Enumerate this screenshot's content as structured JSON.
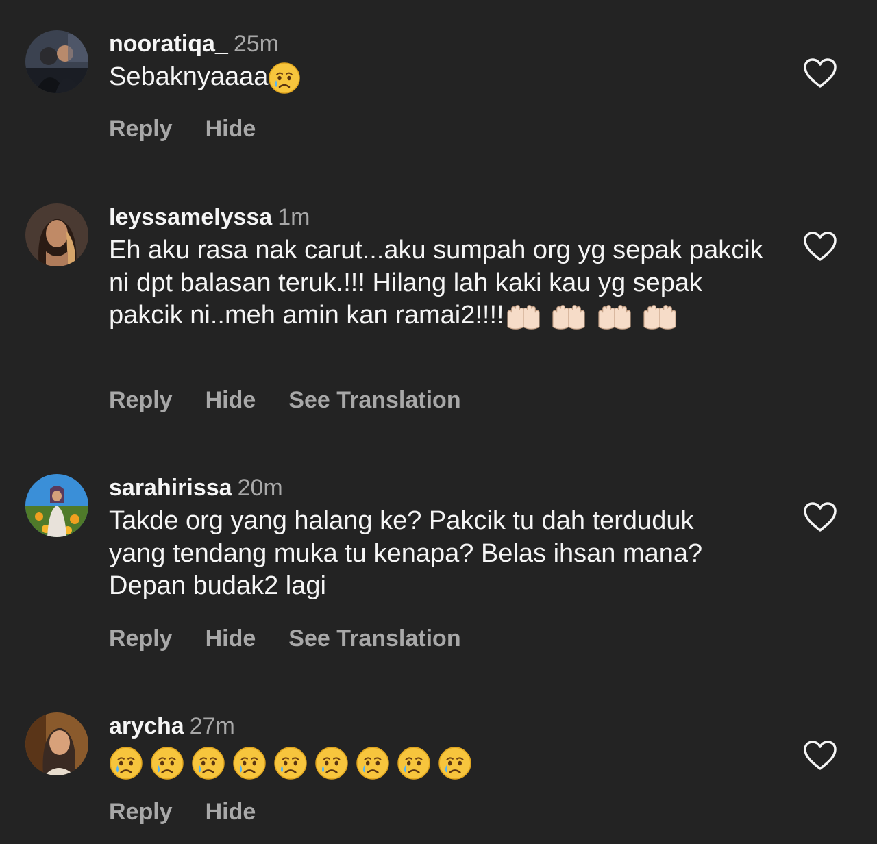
{
  "comments": [
    {
      "username": "nooratiqa_",
      "time": "25m",
      "text": "Sebaknyaaaa",
      "emoji_after": [
        "crying-face"
      ],
      "actions": [
        "Reply",
        "Hide"
      ]
    },
    {
      "username": "leyssamelyssa",
      "time": "1m",
      "text": "Eh aku rasa nak carut...aku sumpah org yg sepak pakcik ni dpt balasan teruk.!!! Hilang lah kaki kau yg sepak pakcik ni..meh amin kan ramai2!!!!",
      "emoji_after": [
        "palms-up-together",
        "palms-up-together",
        "palms-up-together",
        "palms-up-together"
      ],
      "actions": [
        "Reply",
        "Hide",
        "See Translation"
      ]
    },
    {
      "username": "sarahirissa",
      "time": "20m",
      "text": "Takde org yang halang ke? Pakcik tu dah terduduk yang tendang muka tu kenapa? Belas ihsan mana? Depan budak2 lagi",
      "emoji_after": [],
      "actions": [
        "Reply",
        "Hide",
        "See Translation"
      ]
    },
    {
      "username": "arycha",
      "time": "27m",
      "text": "",
      "emoji_after": [
        "crying-face",
        "crying-face",
        "crying-face",
        "crying-face",
        "crying-face",
        "crying-face",
        "crying-face",
        "crying-face",
        "crying-face"
      ],
      "actions": [
        "Reply",
        "Hide"
      ]
    }
  ],
  "icons": {
    "like": "heart-outline-icon"
  },
  "colors": {
    "background": "#232323",
    "primary_text": "#f5f5f5",
    "secondary_text": "#a8a8a8"
  }
}
